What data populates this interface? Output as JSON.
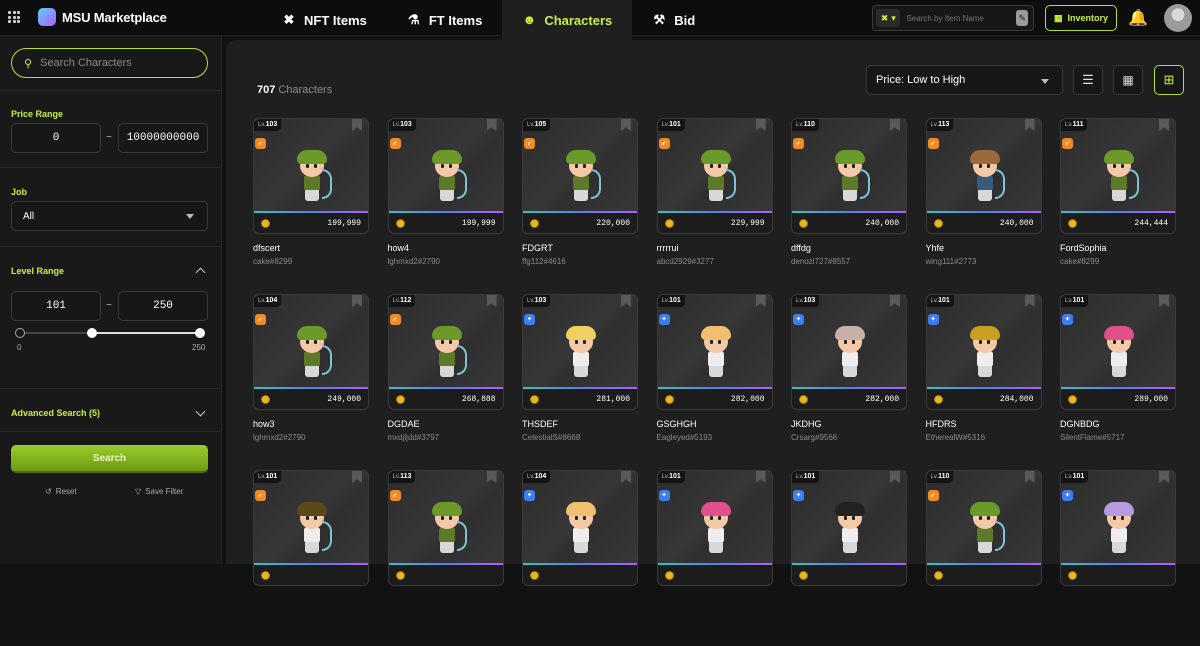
{
  "brand": {
    "name": "MSU Marketplace"
  },
  "nav": {
    "tabs": [
      {
        "label": "NFT Items",
        "icon": "swords-icon",
        "glyph": "✖"
      },
      {
        "label": "FT Items",
        "icon": "potion-icon",
        "glyph": "⚗"
      },
      {
        "label": "Characters",
        "icon": "character-icon",
        "glyph": "☻"
      },
      {
        "label": "Bid",
        "icon": "gavel-icon",
        "glyph": "⚒"
      }
    ],
    "active": "Characters"
  },
  "top_search": {
    "placeholder": "Search by Item Name"
  },
  "inventory": {
    "label": "Inventory"
  },
  "sidebar": {
    "search_placeholder": "Search Characters",
    "price_range": {
      "title": "Price Range",
      "min": "0",
      "max": "10000000000",
      "sep": "~"
    },
    "job": {
      "title": "Job",
      "selected": "All"
    },
    "level_range": {
      "title": "Level Range",
      "min": "101",
      "max": "250",
      "sep": "~",
      "slider_min_label": "0",
      "slider_max_label": "250",
      "slider_min": 0,
      "slider_max": 250
    },
    "advanced": {
      "title": "Advanced Search (5)"
    },
    "search_button": "Search",
    "reset_label": "Reset",
    "save_filter_label": "Save Filter"
  },
  "results": {
    "count": "707",
    "count_label": "Characters",
    "sort": "Price: Low to High"
  },
  "colors": {
    "accent": "#c7f03f",
    "archer_badge": "#f08a24",
    "mage_badge": "#3d7df0"
  },
  "cards": [
    {
      "lv": "103",
      "job": "arch",
      "price": "199,999",
      "name": "dfscert",
      "owner": "cake#8299",
      "hair": "#6a9a2a",
      "body": "#5c7a2a"
    },
    {
      "lv": "103",
      "job": "arch",
      "price": "199,999",
      "name": "how4",
      "owner": "lghmxd2#2790",
      "hair": "#6a9a2a",
      "body": "#5c7a2a"
    },
    {
      "lv": "105",
      "job": "arch",
      "price": "220,000",
      "name": "FDGRT",
      "owner": "ffg112#4616",
      "hair": "#6a9a2a",
      "body": "#5c7a2a"
    },
    {
      "lv": "101",
      "job": "arch",
      "price": "229,999",
      "name": "rrrrrui",
      "owner": "abcd2929#3277",
      "hair": "#6a9a2a",
      "body": "#5c7a2a"
    },
    {
      "lv": "110",
      "job": "arch",
      "price": "240,000",
      "name": "dffdg",
      "owner": "denozi727#8557",
      "hair": "#6a9a2a",
      "body": "#5c7a2a"
    },
    {
      "lv": "113",
      "job": "arch",
      "price": "240,000",
      "name": "Yhfe",
      "owner": "wing111#2773",
      "hair": "#9a6a3a",
      "body": "#3a5a7a"
    },
    {
      "lv": "111",
      "job": "arch",
      "price": "244,444",
      "name": "FordSophia",
      "owner": "cake#8299",
      "hair": "#6a9a2a",
      "body": "#5c7a2a"
    },
    {
      "lv": "104",
      "job": "arch",
      "price": "249,000",
      "name": "how3",
      "owner": "lghmxd2#2790",
      "hair": "#6a9a2a",
      "body": "#5c7a2a"
    },
    {
      "lv": "112",
      "job": "arch",
      "price": "268,888",
      "name": "DGDAE",
      "owner": "mxdjljdd#3797",
      "hair": "#6a9a2a",
      "body": "#5c7a2a"
    },
    {
      "lv": "103",
      "job": "mage",
      "price": "281,000",
      "name": "THSDEF",
      "owner": "CelestialS#8668",
      "hair": "#f0d060",
      "body": "#eeeeee"
    },
    {
      "lv": "101",
      "job": "mage",
      "price": "282,000",
      "name": "GSGHGH",
      "owner": "Eagleyed#5193",
      "hair": "#f0c070",
      "body": "#eeeeee"
    },
    {
      "lv": "103",
      "job": "mage",
      "price": "282,000",
      "name": "JKDHG",
      "owner": "Crsarg#9566",
      "hair": "#c8b0a8",
      "body": "#eeeeee"
    },
    {
      "lv": "101",
      "job": "mage",
      "price": "284,000",
      "name": "HFDRS",
      "owner": "EtherealW#5316",
      "hair": "#c8a020",
      "body": "#eeeeee"
    },
    {
      "lv": "101",
      "job": "mage",
      "price": "289,000",
      "name": "DGNBDG",
      "owner": "SilentFlame#5717",
      "hair": "#e0508a",
      "body": "#eeeeee"
    },
    {
      "lv": "101",
      "job": "arch",
      "price": "",
      "name": "",
      "owner": "",
      "hair": "#5a4a1a",
      "body": "#eeeeee"
    },
    {
      "lv": "113",
      "job": "arch",
      "price": "",
      "name": "",
      "owner": "",
      "hair": "#6a9a2a",
      "body": "#5c7a2a"
    },
    {
      "lv": "104",
      "job": "mage",
      "price": "",
      "name": "",
      "owner": "",
      "hair": "#f0c070",
      "body": "#eeeeee"
    },
    {
      "lv": "101",
      "job": "mage",
      "price": "",
      "name": "",
      "owner": "",
      "hair": "#e0508a",
      "body": "#eeeeee"
    },
    {
      "lv": "101",
      "job": "mage",
      "price": "",
      "name": "",
      "owner": "",
      "hair": "#222222",
      "body": "#eeeeee"
    },
    {
      "lv": "110",
      "job": "arch",
      "price": "",
      "name": "",
      "owner": "",
      "hair": "#6a9a2a",
      "body": "#5c7a2a"
    },
    {
      "lv": "101",
      "job": "mage",
      "price": "",
      "name": "",
      "owner": "",
      "hair": "#b89ae0",
      "body": "#eeeeee"
    }
  ],
  "labels": {
    "lv_prefix": "Lv."
  }
}
